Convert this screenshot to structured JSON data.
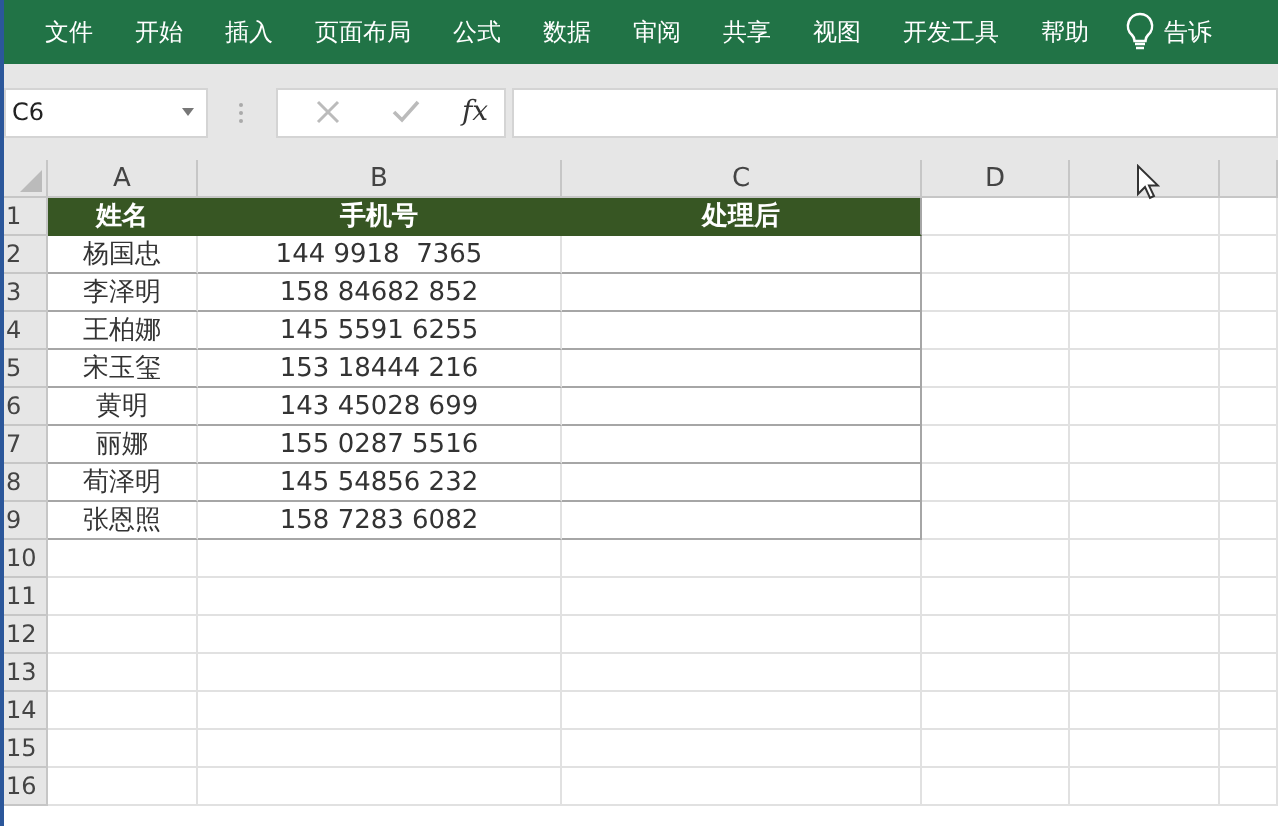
{
  "ribbon": {
    "tabs": [
      {
        "label": "文件"
      },
      {
        "label": "开始"
      },
      {
        "label": "插入"
      },
      {
        "label": "页面布局"
      },
      {
        "label": "公式"
      },
      {
        "label": "数据"
      },
      {
        "label": "审阅"
      },
      {
        "label": "共享"
      },
      {
        "label": "视图"
      },
      {
        "label": "开发工具"
      },
      {
        "label": "帮助"
      }
    ],
    "tell_me": "告诉"
  },
  "formula_bar": {
    "name_box": "C6",
    "function_label": "fx"
  },
  "sheet": {
    "columns": [
      "A",
      "B",
      "C",
      "D"
    ],
    "row_numbers": [
      "1",
      "2",
      "3",
      "4",
      "5",
      "6",
      "7",
      "8",
      "9",
      "10",
      "11",
      "12",
      "13",
      "14",
      "15",
      "16"
    ],
    "header": [
      "姓名",
      "手机号",
      "处理后"
    ],
    "rows": [
      {
        "name": "杨国忠",
        "phone": "144 9918  7365"
      },
      {
        "name": "李泽明",
        "phone": "158 84682 852"
      },
      {
        "name": "王柏娜",
        "phone": "145 5591 6255"
      },
      {
        "name": "宋玉玺",
        "phone": "153 18444 216"
      },
      {
        "name": "黄明",
        "phone": "143 45028 699"
      },
      {
        "name": "丽娜",
        "phone": "155 0287 5516"
      },
      {
        "name": "荀泽明",
        "phone": "145 54856 232"
      },
      {
        "name": "张恩照",
        "phone": "158 7283 6082"
      }
    ]
  }
}
